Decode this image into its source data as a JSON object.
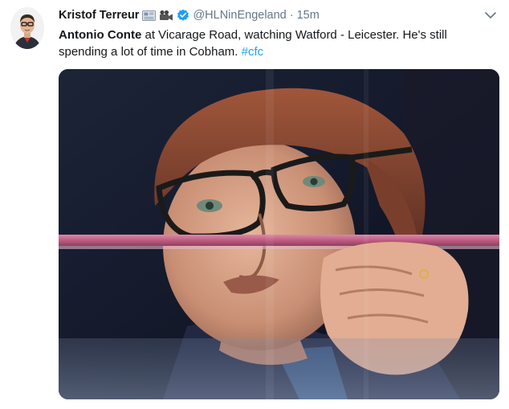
{
  "tweet": {
    "author": {
      "display_name": "Kristof Terreur",
      "handle": "@HLNinEngeland",
      "name_emoji_icons": [
        "newspaper-icon",
        "movie-camera-icon"
      ],
      "verified": true
    },
    "timestamp": "15m",
    "separator": "·",
    "text": {
      "bold_lead": "Antonio Conte",
      "body": " at Vicarage Road, watching Watford - Leicester. He's still spending a lot of time in Cobham. ",
      "hashtag": "#cfc"
    },
    "media": {
      "type": "photo"
    }
  },
  "colors": {
    "name": "#14171a",
    "meta": "#657786",
    "hashtag": "#1da1f2",
    "verified": "#1da1f2"
  },
  "icons": {
    "verified": "verified-badge-icon",
    "menu": "chevron-down-icon"
  }
}
